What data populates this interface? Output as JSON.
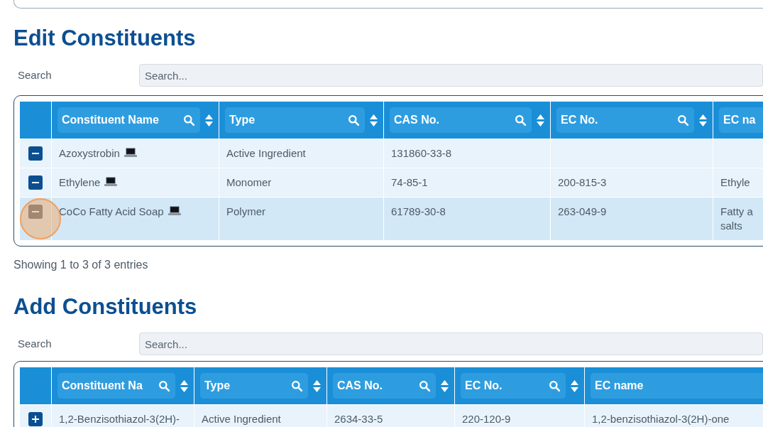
{
  "sections": [
    {
      "title": "Edit Constituents",
      "search": {
        "label": "Search",
        "placeholder": "Search..."
      },
      "table": {
        "columns": [
          {
            "label": "Constituent Name",
            "searchable": true,
            "sortable": true
          },
          {
            "label": "Type",
            "searchable": true,
            "sortable": true
          },
          {
            "label": "CAS No.",
            "searchable": true,
            "sortable": true
          },
          {
            "label": "EC No.",
            "searchable": true,
            "sortable": true
          },
          {
            "label": "EC na",
            "searchable": false,
            "sortable": false
          }
        ],
        "rows": [
          {
            "kind": "remove",
            "highlighted": false,
            "click_marker": false,
            "device_icon": true,
            "cells": [
              "Azoxystrobin",
              "Active Ingredient",
              "131860-33-8",
              "",
              ""
            ]
          },
          {
            "kind": "remove",
            "highlighted": false,
            "click_marker": false,
            "device_icon": true,
            "cells": [
              "Ethylene",
              "Monomer",
              "74-85-1",
              "200-815-3",
              "Ethyle"
            ]
          },
          {
            "kind": "remove",
            "highlighted": true,
            "click_marker": true,
            "device_icon": true,
            "cells": [
              "CoCo Fatty Acid Soap",
              "Polymer",
              "61789-30-8",
              "263-049-9",
              "Fatty a\nsalts"
            ]
          }
        ]
      },
      "footer": "Showing 1 to 3 of 3 entries"
    },
    {
      "title": "Add Constituents",
      "search": {
        "label": "Search",
        "placeholder": "Search..."
      },
      "table": {
        "columns": [
          {
            "label": "Constituent Na",
            "searchable": true,
            "sortable": true
          },
          {
            "label": "Type",
            "searchable": true,
            "sortable": true
          },
          {
            "label": "CAS No.",
            "searchable": true,
            "sortable": true
          },
          {
            "label": "EC No.",
            "searchable": true,
            "sortable": true
          },
          {
            "label": "EC name",
            "searchable": false,
            "sortable": false
          }
        ],
        "rows": [
          {
            "kind": "add",
            "highlighted": false,
            "click_marker": false,
            "device_icon": false,
            "cells": [
              "1,2-Benzisothiazol-3(2H)-",
              "Active Ingredient",
              "2634-33-5",
              "220-120-9",
              "1,2-benzisothiazol-3(2H)-one"
            ]
          }
        ]
      }
    }
  ]
}
